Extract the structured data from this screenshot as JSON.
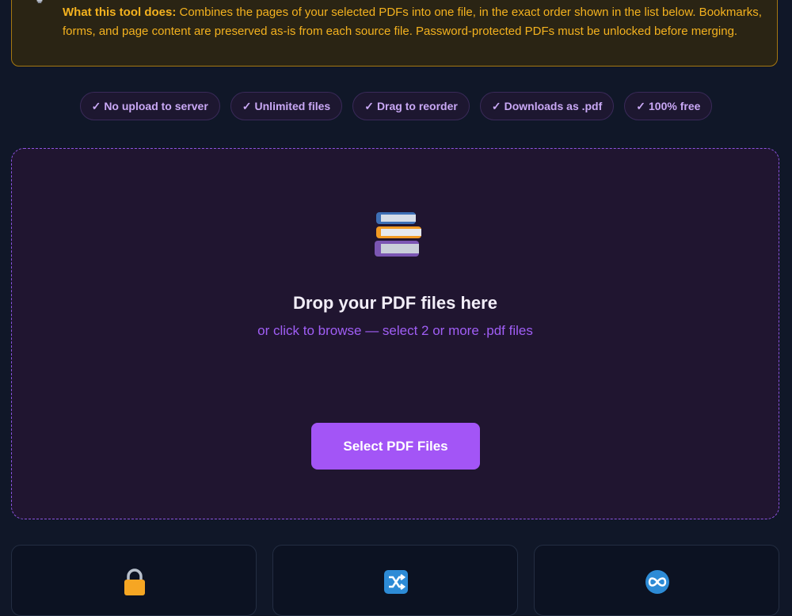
{
  "info": {
    "icon": "lightbulb-icon",
    "heading": "What this tool does:",
    "text": " Combines the pages of your selected PDFs into one file, in the exact order shown in the list below. Bookmarks, forms, and page content are preserved as-is from each source file. Password-protected PDFs must be unlocked before merging."
  },
  "badges": [
    {
      "check": "✓",
      "label": "No upload to server"
    },
    {
      "check": "✓",
      "label": "Unlimited files"
    },
    {
      "check": "✓",
      "label": "Drag to reorder"
    },
    {
      "check": "✓",
      "label": "Downloads as .pdf"
    },
    {
      "check": "✓",
      "label": "100% free"
    }
  ],
  "dropzone": {
    "icon": "books-icon",
    "title": "Drop your PDF files here",
    "subtitle": "or click to browse — select 2 or more .pdf files",
    "button_label": "Select PDF Files"
  },
  "feature_cards": [
    {
      "icon": "lock-icon"
    },
    {
      "icon": "shuffle-icon"
    },
    {
      "icon": "infinity-icon"
    }
  ],
  "colors": {
    "background": "#101728",
    "accent": "#a355f6",
    "warning": "#f4b21f"
  }
}
